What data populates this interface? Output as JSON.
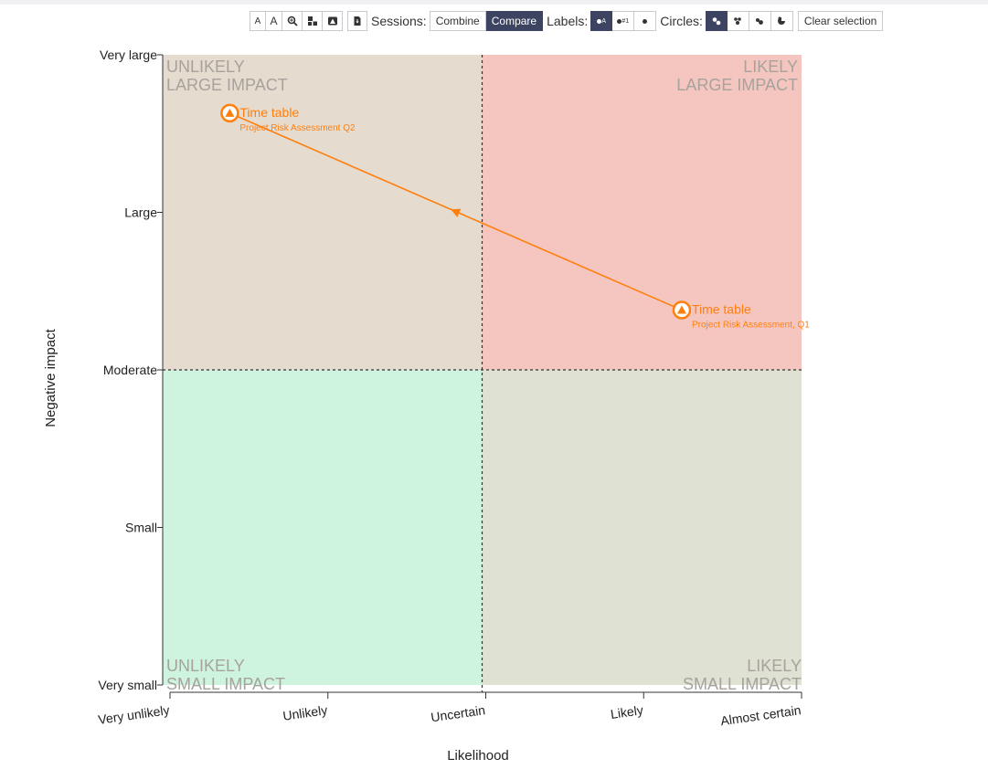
{
  "toolbar": {
    "text_small": "A",
    "text_large": "A",
    "sessions_label": "Sessions:",
    "session_options": [
      "Combine",
      "Compare"
    ],
    "session_selected": "Compare",
    "labels_label": "Labels:",
    "label_options": [
      {
        "icon": "dot-letter-icon",
        "glyph": "A"
      },
      {
        "icon": "dot-number-icon",
        "glyph": "#1"
      },
      {
        "icon": "dot-only-icon",
        "glyph": ""
      }
    ],
    "circles_label": "Circles:",
    "circle_options": [
      "circles-separate-icon",
      "circles-tri-icon",
      "circles-pair-icon",
      "circles-merged-icon"
    ],
    "clear_label": "Clear selection"
  },
  "colors": {
    "accent": "#ff7f0e",
    "quad_top_left": "#e5dbcf",
    "quad_top_right": "#f5c6c0",
    "quad_bottom_left": "#cef3de",
    "quad_bottom_right": "#dfe1d3",
    "toolbar_active": "#3d4462"
  },
  "chart_data": {
    "type": "scatter",
    "xlabel": "Likelihood",
    "ylabel": "Negative impact",
    "x_categories": [
      "Very unlikely",
      "Unlikely",
      "Uncertain",
      "Likely",
      "Almost certain"
    ],
    "y_categories": [
      "Very small",
      "Small",
      "Moderate",
      "Large",
      "Very large"
    ],
    "xlim": [
      0,
      4
    ],
    "ylim": [
      0,
      4
    ],
    "quadrants": [
      {
        "id": "top-left",
        "lines": [
          "UNLIKELY",
          "LARGE IMPACT"
        ],
        "align": "left"
      },
      {
        "id": "top-right",
        "lines": [
          "LIKELY",
          "LARGE IMPACT"
        ],
        "align": "right"
      },
      {
        "id": "bottom-left",
        "lines": [
          "UNLIKELY",
          "SMALL IMPACT"
        ],
        "align": "left"
      },
      {
        "id": "bottom-right",
        "lines": [
          "LIKELY",
          "SMALL IMPACT"
        ],
        "align": "right"
      }
    ],
    "points": [
      {
        "name": "Time table",
        "session": "Project Risk Assessment, Q1",
        "x": 3.25,
        "y": 2.38
      },
      {
        "name": "Time table",
        "session": "Project Risk Assessment Q2",
        "x": 0.42,
        "y": 3.63
      }
    ],
    "arrow": {
      "from": 0,
      "to": 1
    }
  }
}
